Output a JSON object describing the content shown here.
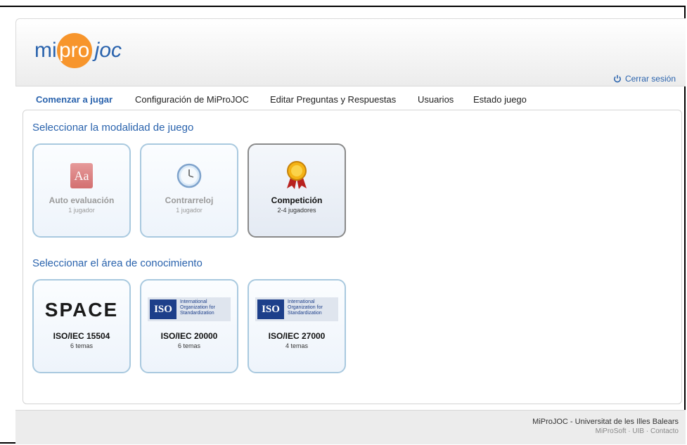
{
  "logo": {
    "mi": "mi",
    "pro": "pro",
    "joc": "joc"
  },
  "header": {
    "logout_label": "Cerrar sesión"
  },
  "nav": {
    "items": [
      {
        "label": "Comenzar a jugar",
        "active": true
      },
      {
        "label": "Configuración de MiProJOC",
        "active": false
      },
      {
        "label": "Editar Preguntas y Respuestas",
        "active": false
      },
      {
        "label": "Usuarios",
        "active": false
      },
      {
        "label": "Estado juego",
        "active": false
      }
    ]
  },
  "mode_section": {
    "title": "Seleccionar la modalidad de juego",
    "cards": [
      {
        "icon": "dictionary-icon",
        "icon_text": "Aa",
        "title": "Auto evaluación",
        "subtitle": "1 jugador",
        "selected": false
      },
      {
        "icon": "clock-icon",
        "title": "Contrarreloj",
        "subtitle": "1 jugador",
        "selected": false
      },
      {
        "icon": "medal-icon",
        "title": "Competición",
        "subtitle": "2-4 jugadores",
        "selected": true
      }
    ]
  },
  "area_section": {
    "title": "Seleccionar el área de conocimiento",
    "cards": [
      {
        "logo": "space-logo",
        "logo_text": "SPACE",
        "title": "ISO/IEC 15504",
        "subtitle": "6 temas"
      },
      {
        "logo": "iso-logo",
        "logo_box": "ISO",
        "logo_text": "International Organization for Standardization",
        "title": "ISO/IEC 20000",
        "subtitle": "6 temas"
      },
      {
        "logo": "iso-logo",
        "logo_box": "ISO",
        "logo_text": "International Organization for Standardization",
        "title": "ISO/IEC 27000",
        "subtitle": "4 temas"
      }
    ]
  },
  "footer": {
    "line1": "MiProJOC - Universitat de les Illes Balears",
    "line2": "MiProSoft · UIB · Contacto"
  },
  "colors": {
    "accent": "#2a63ad",
    "logo_orange": "#f7952c",
    "card_border": "#a9c9df"
  }
}
